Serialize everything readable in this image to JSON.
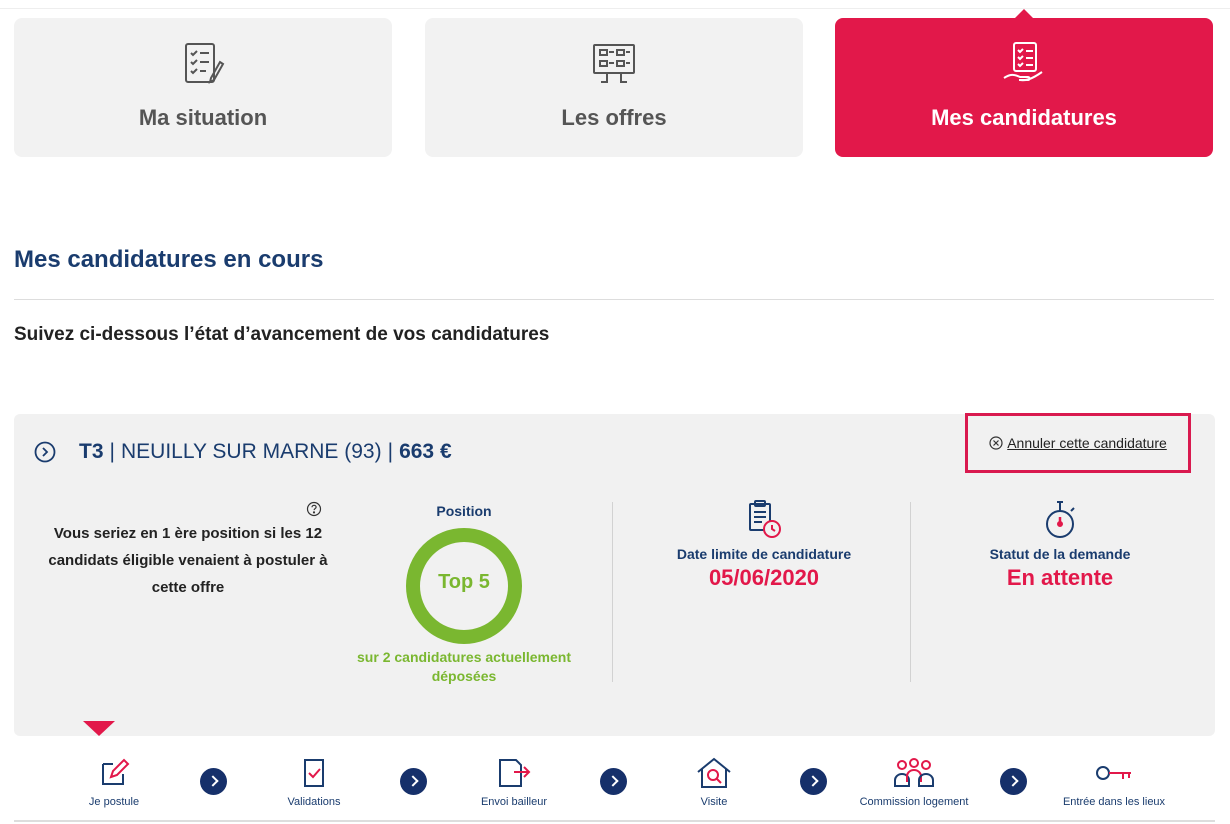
{
  "tabs": [
    {
      "label": "Ma situation",
      "icon": "checklist-pen-icon",
      "active": false
    },
    {
      "label": "Les offres",
      "icon": "board-grid-icon",
      "active": false
    },
    {
      "label": "Mes candidatures",
      "icon": "hand-checklist-icon",
      "active": true
    }
  ],
  "section": {
    "title": "Mes candidatures en cours",
    "subtitle": "Suivez ci-dessous l’état d’avancement de vos candidatures"
  },
  "application": {
    "type": "T3",
    "location": "NEUILLY SUR MARNE (93)",
    "separator": "|",
    "price": "663 €",
    "cancel_label": "Annuler cette candidature",
    "info_text": "Vous seriez en 1 ère position si les 12 candidats éligible venaient à postuler à cette offre",
    "position_label": "Position",
    "position_value": "Top 5",
    "position_sub": "sur 2 candidatures actuellement déposées",
    "deadline_label": "Date limite de candidature",
    "deadline_value": "05/06/2020",
    "status_label": "Statut de la demande",
    "status_value": "En attente"
  },
  "steps": [
    {
      "label": "Je postule",
      "icon": "edit-pen-icon",
      "current": true
    },
    {
      "label": "Validations",
      "icon": "document-check-icon"
    },
    {
      "label": "Envoi bailleur",
      "icon": "document-send-icon"
    },
    {
      "label": "Visite",
      "icon": "house-search-icon"
    },
    {
      "label": "Commission logement",
      "icon": "group-people-icon"
    },
    {
      "label": "Entrée dans les lieux",
      "icon": "key-icon"
    }
  ],
  "colors": {
    "accent": "#e2184a",
    "navy": "#1a3c6e",
    "green": "#7ab730",
    "step_arrow": "#16306a"
  }
}
